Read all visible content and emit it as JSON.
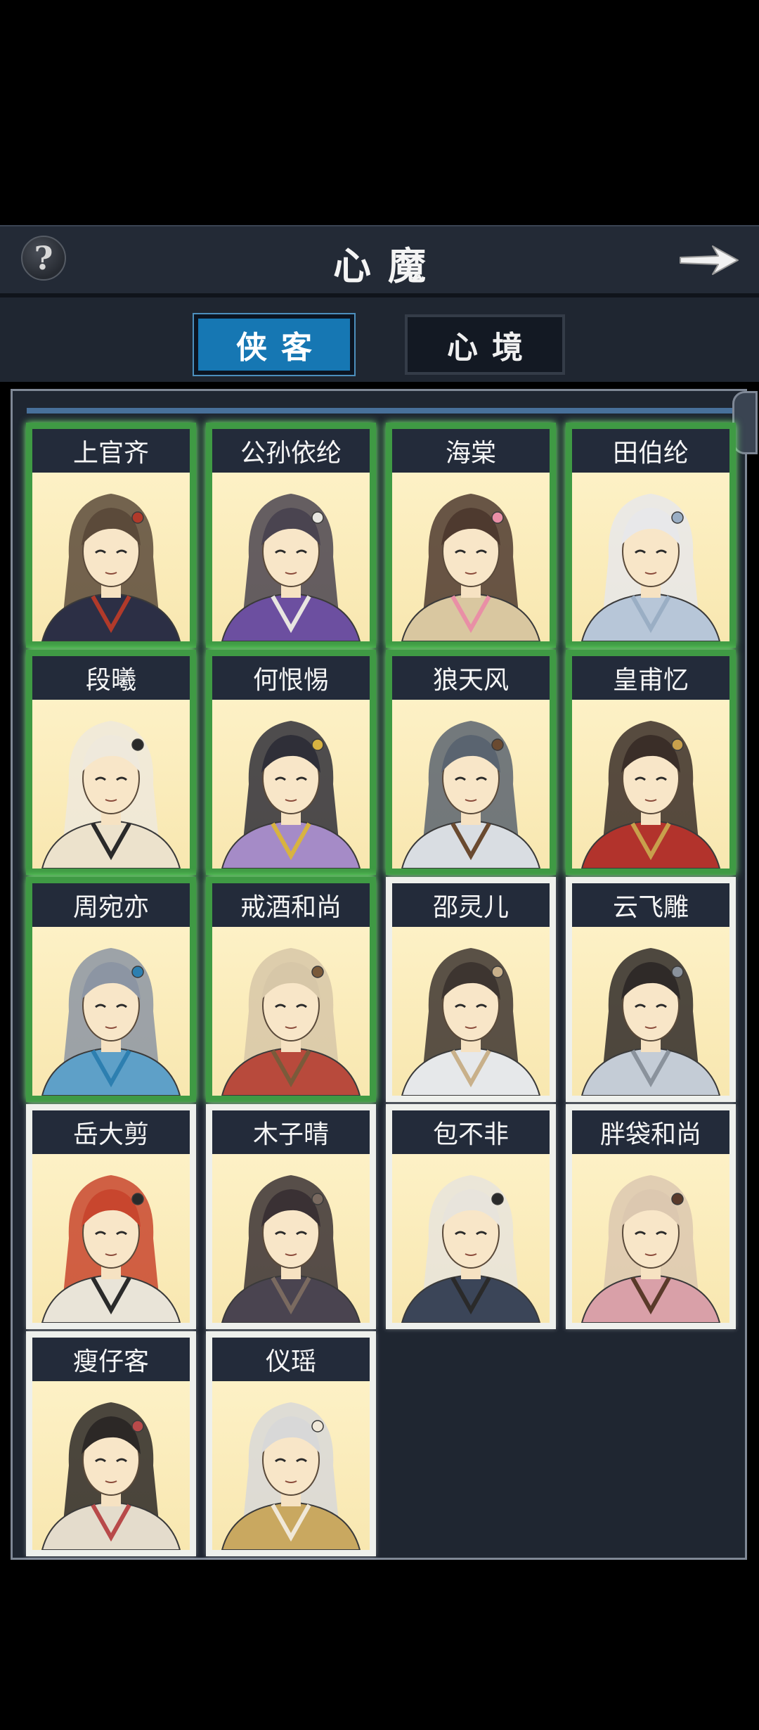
{
  "header": {
    "title": "心魔",
    "help_label": "?"
  },
  "tabs": [
    {
      "label": "侠客",
      "selected": true
    },
    {
      "label": "心境",
      "selected": false
    }
  ],
  "characters": [
    {
      "name": "上官齐",
      "active": true,
      "hair": "#5b4a3a",
      "robe": "#2c2f45",
      "accent": "#b13a2a"
    },
    {
      "name": "公孙依纶",
      "active": true,
      "hair": "#4a4450",
      "robe": "#6c4fa0",
      "accent": "#e8e6e0"
    },
    {
      "name": "海棠",
      "active": true,
      "hair": "#4e3a2f",
      "robe": "#d9c7a0",
      "accent": "#e98fa6"
    },
    {
      "name": "田伯纶",
      "active": true,
      "hair": "#e8e8ea",
      "robe": "#b7c6d8",
      "accent": "#9aaec4"
    },
    {
      "name": "段曦",
      "active": true,
      "hair": "#efe9dc",
      "robe": "#ece2cc",
      "accent": "#2a2a2a"
    },
    {
      "name": "何恨惕",
      "active": true,
      "hair": "#2f2f38",
      "robe": "#a58bc7",
      "accent": "#d8b341"
    },
    {
      "name": "狼天风",
      "active": true,
      "hair": "#5a6470",
      "robe": "#d9dde2",
      "accent": "#6a4a30"
    },
    {
      "name": "皇甫忆",
      "active": true,
      "hair": "#3a2e28",
      "robe": "#b2332c",
      "accent": "#c8a04c"
    },
    {
      "name": "周宛亦",
      "active": true,
      "hair": "#8c95a3",
      "robe": "#5ea0c8",
      "accent": "#2d7fb0"
    },
    {
      "name": "戒酒和尚",
      "active": true,
      "hair": "#d7c7a8",
      "robe": "#b84a3c",
      "accent": "#7a5a3a"
    },
    {
      "name": "邵灵儿",
      "active": false,
      "hair": "#3d3530",
      "robe": "#e6e8ea",
      "accent": "#c8b08a"
    },
    {
      "name": "云飞雕",
      "active": false,
      "hair": "#2f2a28",
      "robe": "#c4ccd6",
      "accent": "#8a929c"
    },
    {
      "name": "岳大剪",
      "active": false,
      "hair": "#c8462e",
      "robe": "#e9e4d8",
      "accent": "#2a2a2a"
    },
    {
      "name": "木子晴",
      "active": false,
      "hair": "#3a3134",
      "robe": "#4a4450",
      "accent": "#7a6a60"
    },
    {
      "name": "包不非",
      "active": false,
      "hair": "#e8e4dc",
      "robe": "#3b4558",
      "accent": "#2a2a2a"
    },
    {
      "name": "胖袋和尚",
      "active": false,
      "hair": "#dcc8b0",
      "robe": "#d9a0a8",
      "accent": "#5a3a2a"
    },
    {
      "name": "瘦仔客",
      "active": false,
      "hair": "#2c2826",
      "robe": "#e4dccc",
      "accent": "#b84a4a"
    },
    {
      "name": "仪瑶",
      "active": false,
      "hair": "#d8d8d8",
      "robe": "#c9a860",
      "accent": "#f0e8d8"
    }
  ]
}
